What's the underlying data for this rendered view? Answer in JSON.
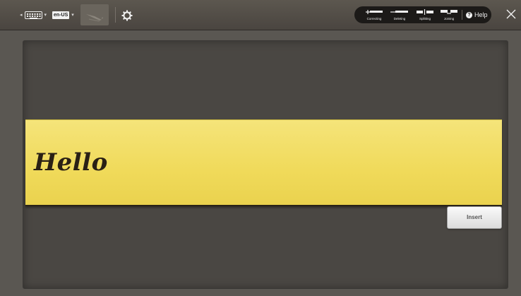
{
  "toolbar": {
    "keyboard_icon": "keyboard-icon",
    "language_label": "en-US",
    "handwriting_icon": "handwriting-pen-icon",
    "settings_icon": "gear-icon",
    "help_label": "Help",
    "close_icon": "close-icon"
  },
  "gestures": [
    {
      "label": "Correcting",
      "icon": "correcting-gesture-icon"
    },
    {
      "label": "Deleting",
      "icon": "deleting-gesture-icon"
    },
    {
      "label": "Splitting",
      "icon": "splitting-gesture-icon"
    },
    {
      "label": "Joining",
      "icon": "joining-gesture-icon"
    }
  ],
  "writing_pad": {
    "recognized_text": "Hello",
    "background_color": "#f2dc5d"
  },
  "actions": {
    "insert_label": "Insert"
  }
}
